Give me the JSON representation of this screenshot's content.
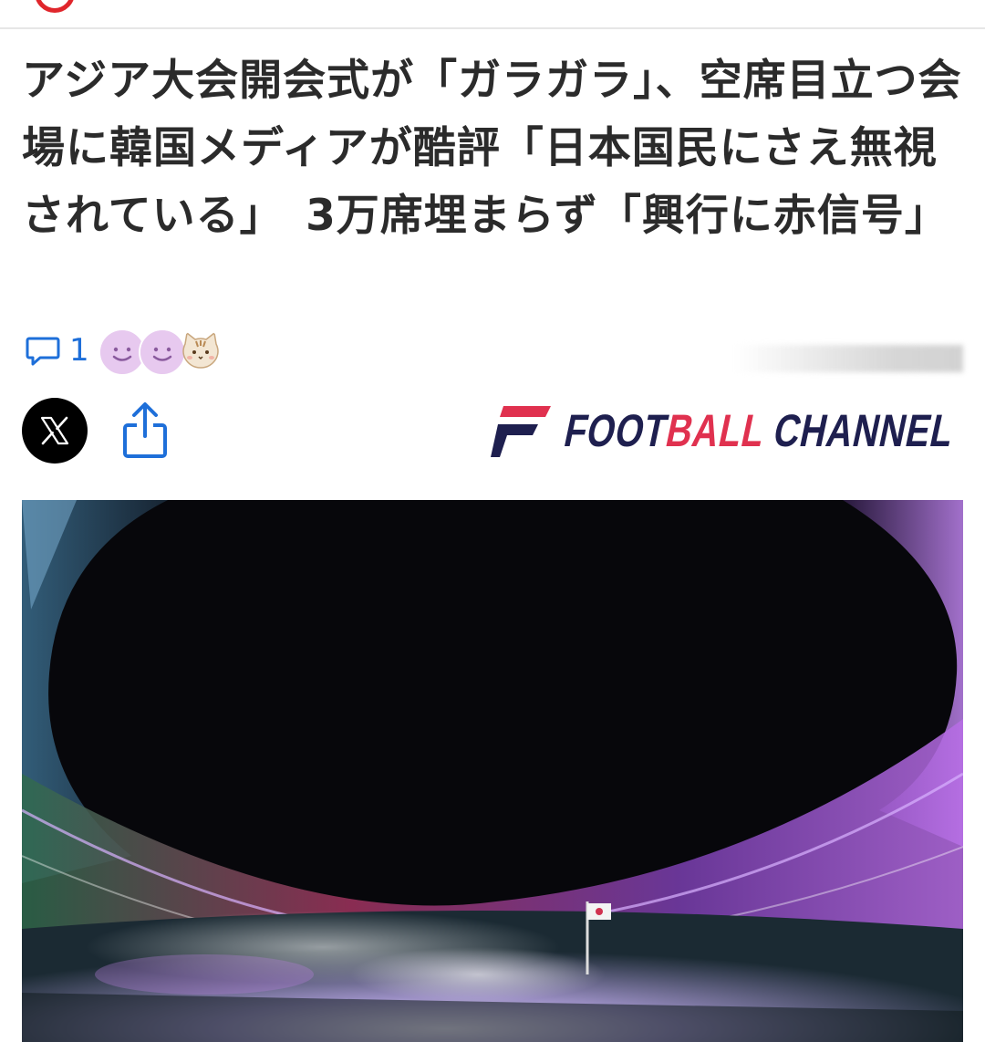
{
  "header": {
    "brand_icon": "site-logo-ring",
    "accent_color": "#e0262c"
  },
  "article": {
    "headline": "アジア大会開会式が「ガラガラ」、空席目立つ会場に韓国メディアが酷評「日本国民にさえ無視されている」　3万席埋まらず「興行に赤信号」",
    "comment_count": "1",
    "comment_icon": "speech-bubble-icon",
    "reactions": [
      "smile-face-icon",
      "smile-face-icon",
      "cat-face-icon"
    ],
    "accent_color": "#1e6fd9"
  },
  "share": {
    "x_icon": "x-logo-icon",
    "share_icon": "share-upload-icon"
  },
  "source_logo": {
    "part1": "FOOT",
    "part2": "BALL",
    "part3": " CHANNEL",
    "navy": "#1e1f4f",
    "red": "#e0314f"
  },
  "hero_image": {
    "subject": "stadium-night-ceremony-photo"
  }
}
